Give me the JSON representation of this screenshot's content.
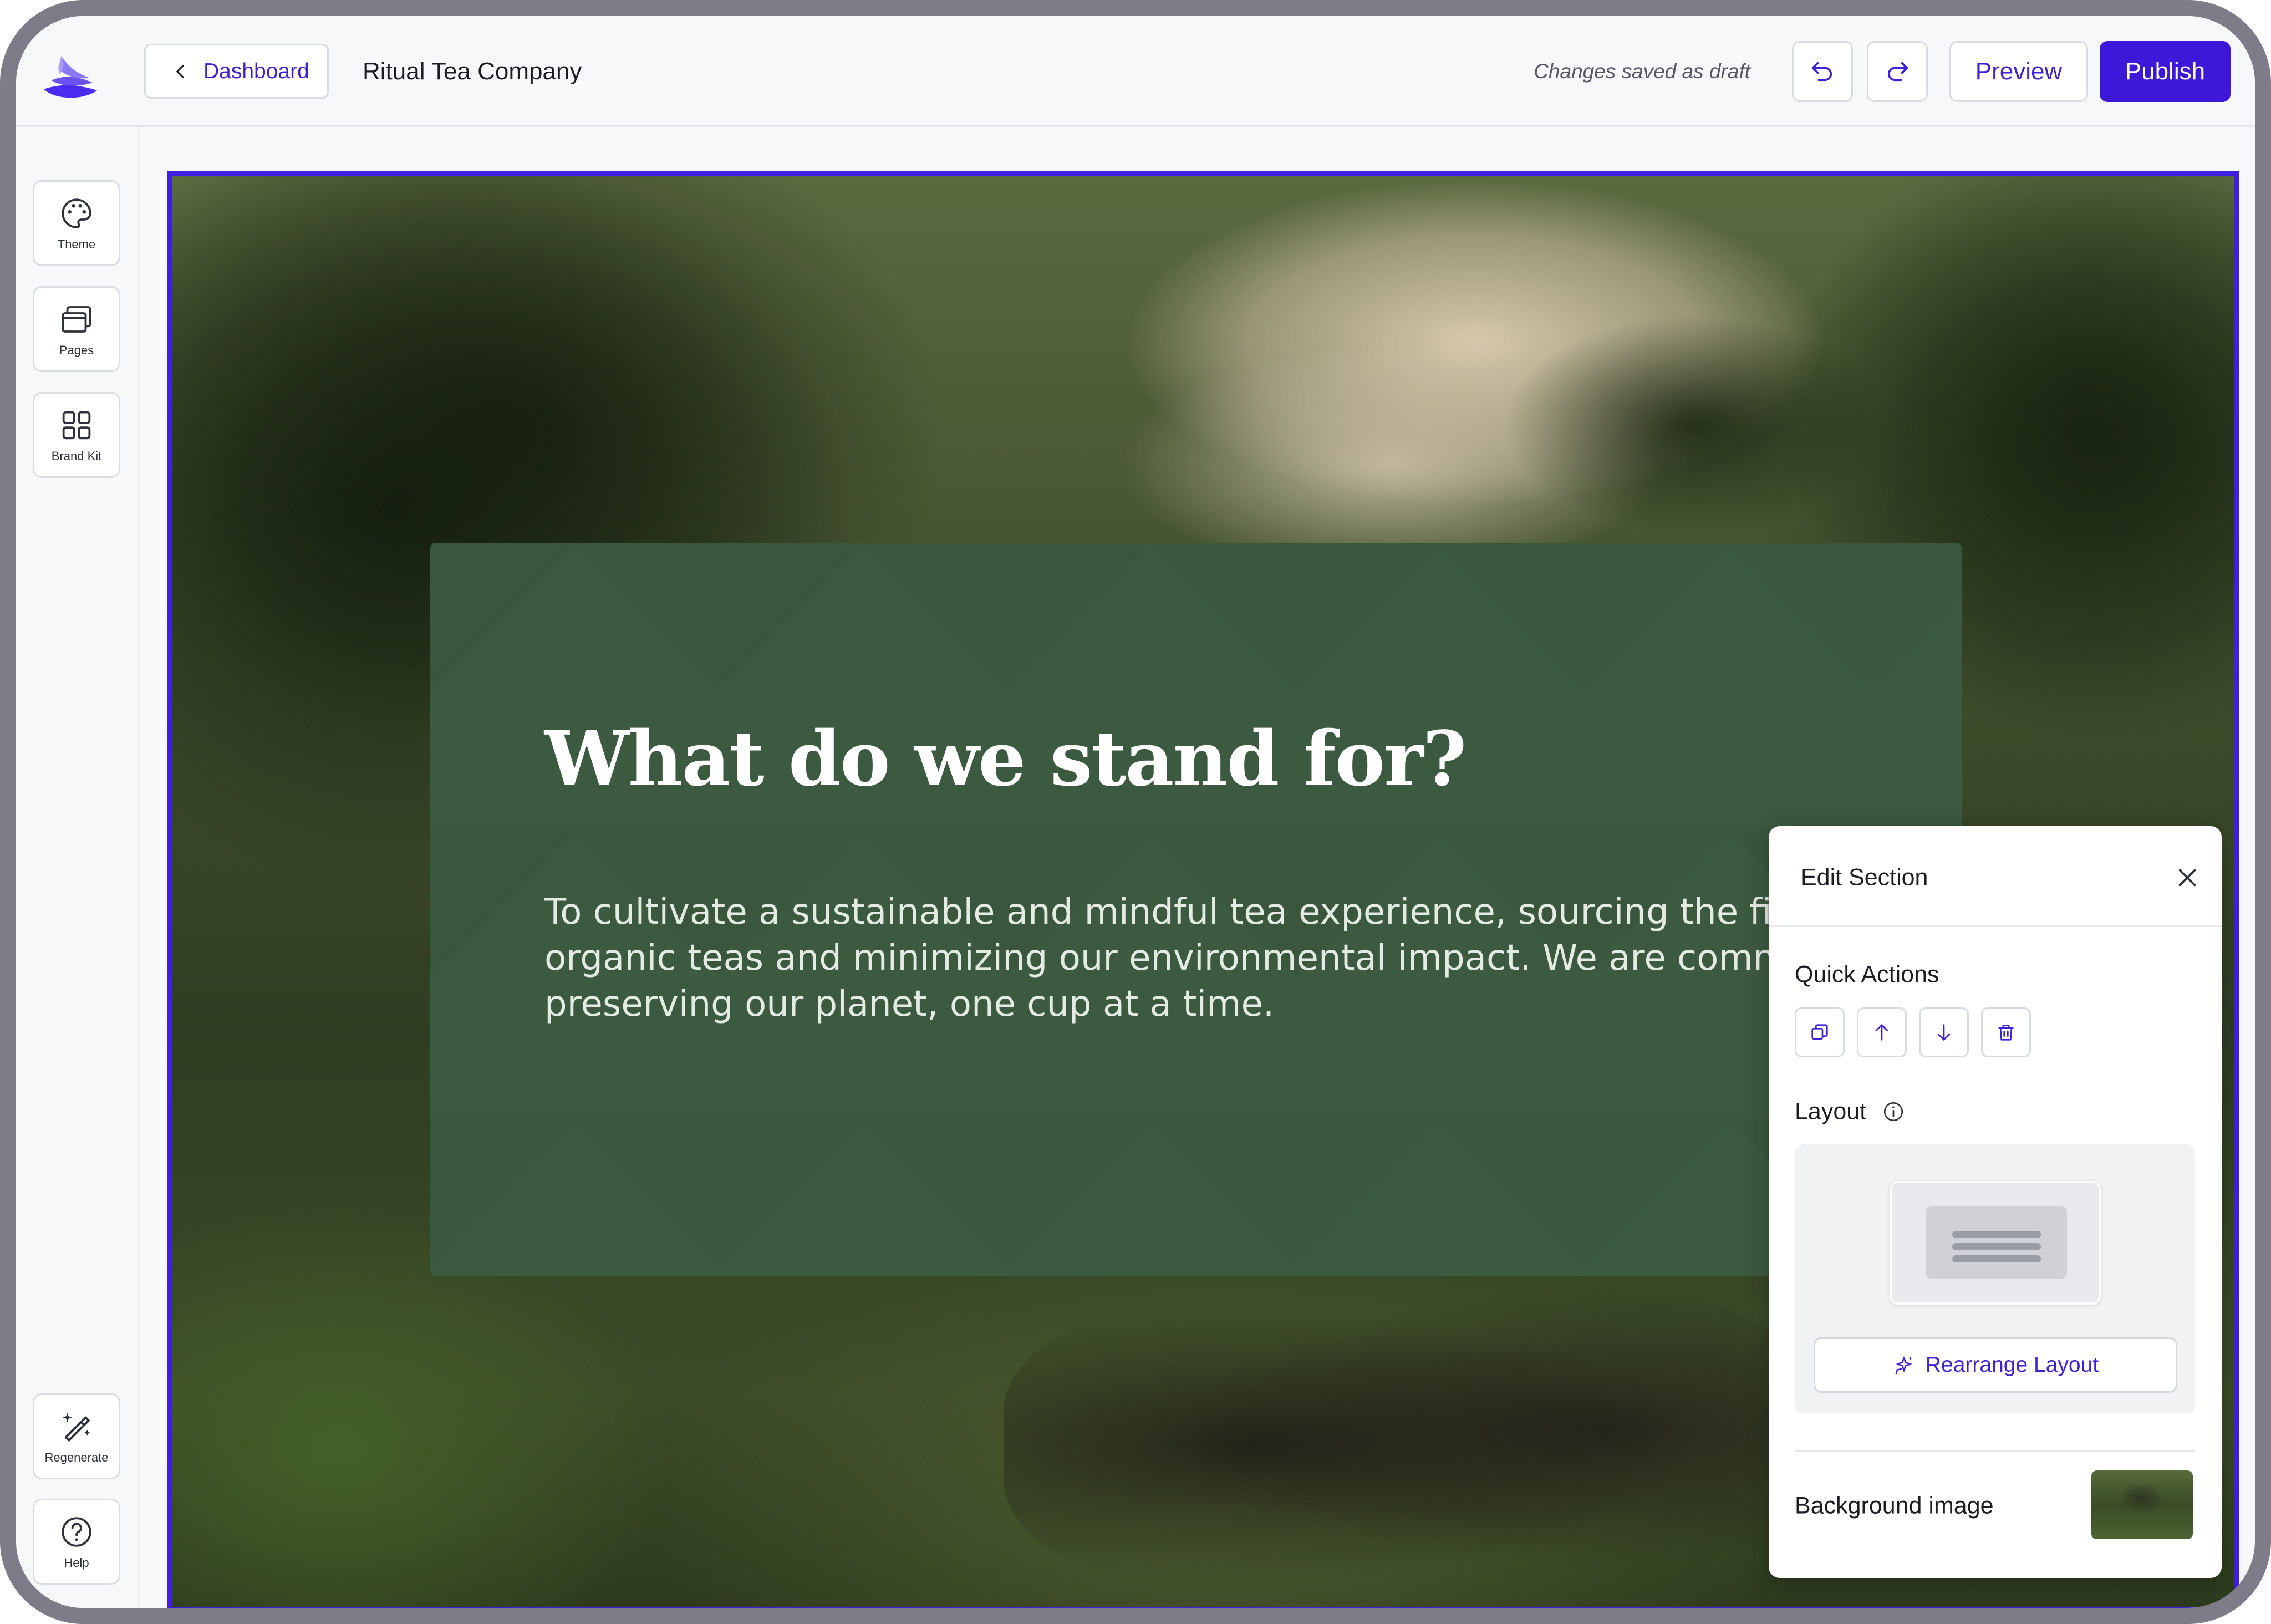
{
  "header": {
    "back_label": "Dashboard",
    "site_name": "Ritual Tea Company",
    "status": "Changes saved as draft",
    "preview_label": "Preview",
    "publish_label": "Publish"
  },
  "sidebar": {
    "top_items": [
      {
        "label": "Theme",
        "icon": "palette-icon"
      },
      {
        "label": "Pages",
        "icon": "pages-icon"
      },
      {
        "label": "Brand Kit",
        "icon": "grid-icon"
      }
    ],
    "bottom_items": [
      {
        "label": "Regenerate",
        "icon": "magic-wand-icon"
      },
      {
        "label": "Help",
        "icon": "help-icon"
      }
    ]
  },
  "section": {
    "title": "What do we stand for?",
    "body": "To cultivate a sustainable and mindful tea experience, sourcing the finest organic teas and minimizing our environmental impact. We are committed to preserving our planet, one cup at a time."
  },
  "edit_panel": {
    "title": "Edit Section",
    "quick_actions_label": "Quick Actions",
    "quick_actions": [
      "duplicate-icon",
      "arrow-up-icon",
      "arrow-down-icon",
      "trash-icon"
    ],
    "layout_label": "Layout",
    "rearrange_label": "Rearrange Layout",
    "background_label": "Background image"
  },
  "colors": {
    "accent": "#3d18d8",
    "card_bg": "#3c5a40",
    "selection_border": "#3f20e0"
  }
}
